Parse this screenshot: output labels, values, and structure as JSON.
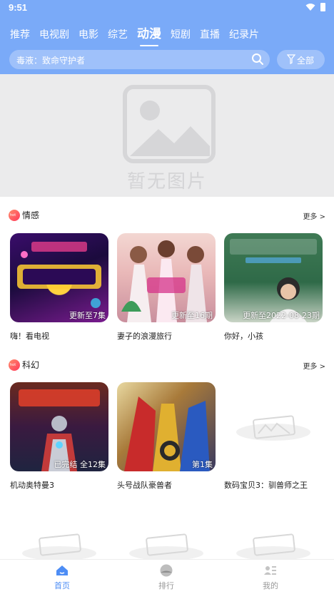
{
  "status_bar": {
    "time": "9:51"
  },
  "tabs": [
    {
      "label": "推荐"
    },
    {
      "label": "电视剧"
    },
    {
      "label": "电影"
    },
    {
      "label": "综艺"
    },
    {
      "label": "动漫",
      "active": true
    },
    {
      "label": "短剧"
    },
    {
      "label": "直播"
    },
    {
      "label": "纪录片"
    }
  ],
  "search": {
    "text": "毒液：致命守护者"
  },
  "filter": {
    "label": "全部",
    "icon": "filter-icon"
  },
  "banner": {
    "placeholder_text": "暂无图片",
    "icon": "image-placeholder-icon"
  },
  "sections": [
    {
      "title": "情感",
      "more": "更多 >",
      "items": [
        {
          "name": "嗨！看电视",
          "overlay": "更新至7集"
        },
        {
          "name": "妻子的浪漫旅行",
          "overlay": "更新至16期"
        },
        {
          "name": "你好，小孩",
          "overlay": "更新至2022-08-23期"
        }
      ]
    },
    {
      "title": "科幻",
      "more": "更多 >",
      "items": [
        {
          "name": "机动奥特曼3",
          "overlay": "已完结 全12集"
        },
        {
          "name": "头号战队豪兽者",
          "overlay": "第1集"
        },
        {
          "name": "数码宝贝3：驯兽师之王",
          "overlay": ""
        }
      ]
    }
  ],
  "bottom_nav": [
    {
      "label": "首页",
      "icon": "home-icon",
      "active": true
    },
    {
      "label": "排行",
      "icon": "ranking-icon"
    },
    {
      "label": "我的",
      "icon": "profile-icon"
    }
  ],
  "colors": {
    "header": "#7aaaf8",
    "accent": "#4d8df5",
    "hot_badge": "#ff3b5c"
  }
}
